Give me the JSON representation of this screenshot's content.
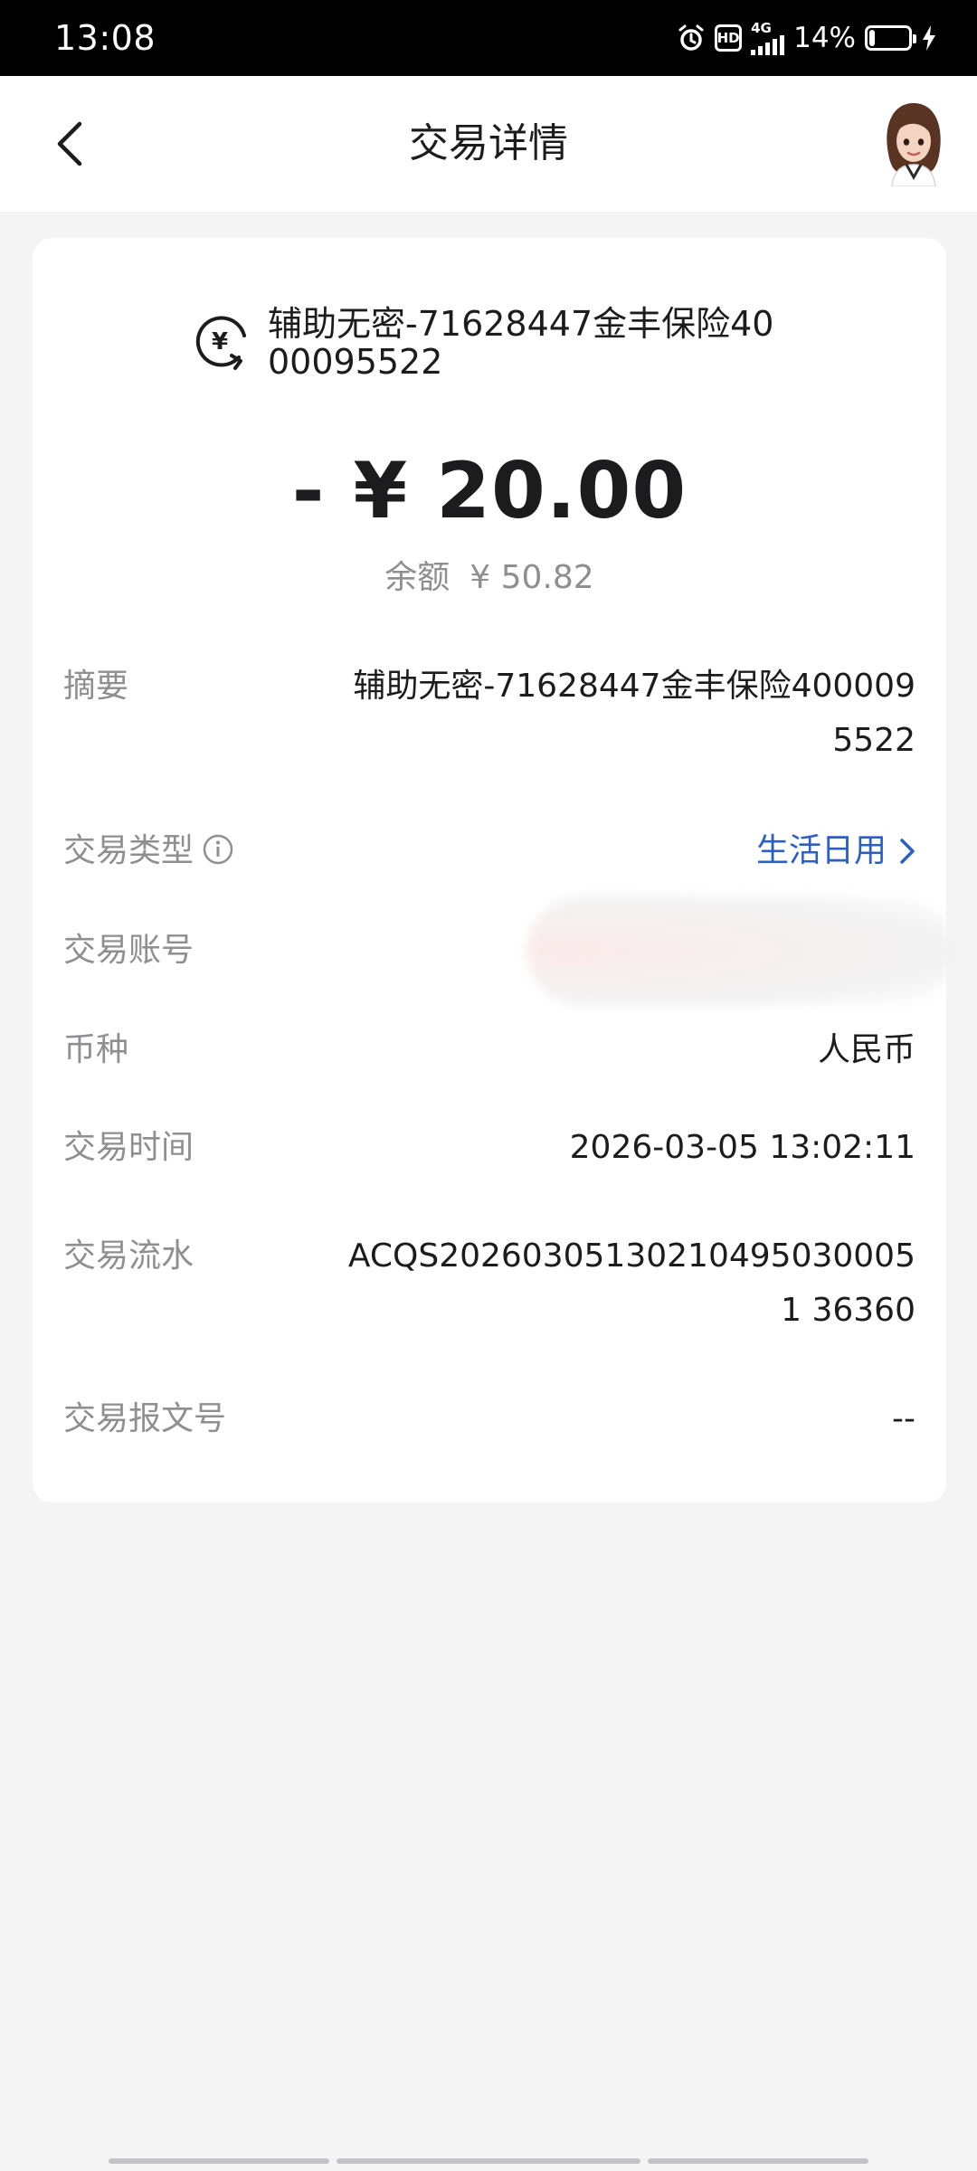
{
  "status_bar": {
    "time": "13:08",
    "network": "4G",
    "battery": "14%",
    "battery_level": 0.14
  },
  "nav": {
    "title": "交易详情"
  },
  "transaction": {
    "merchant": "辅助无密-71628447金丰保险4000095522",
    "amount": "- ¥ 20.00",
    "balance_label": "余额",
    "balance_value": "¥ 50.82"
  },
  "details": [
    {
      "label": "摘要",
      "value": "辅助无密-71628447金丰保险4000095522"
    },
    {
      "label": "交易类型",
      "value": "生活日用"
    },
    {
      "label": "交易账号",
      "value": ""
    },
    {
      "label": "币种",
      "value": "人民币"
    },
    {
      "label": "交易时间",
      "value": "2026-03-05 13:02:11"
    },
    {
      "label": "交易流水",
      "value": "ACQS202603051302104950300051 36360"
    },
    {
      "label": "交易报文号",
      "value": "--"
    }
  ],
  "colors": {
    "link": "#2b5fc6",
    "muted": "#8e8e93",
    "background": "#f4f4f5"
  }
}
